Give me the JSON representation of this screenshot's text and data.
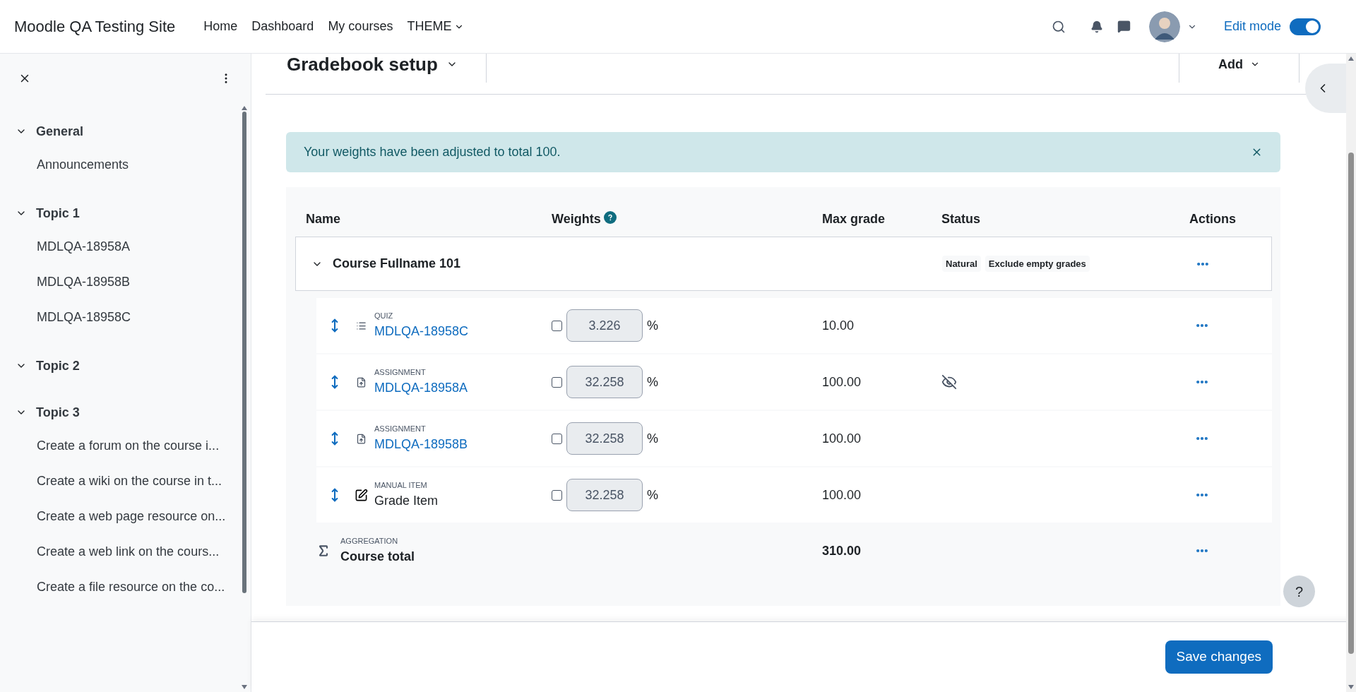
{
  "navbar": {
    "site_name": "Moodle QA Testing Site",
    "links": [
      {
        "label": "Home",
        "dropdown": false
      },
      {
        "label": "Dashboard",
        "dropdown": false
      },
      {
        "label": "My courses",
        "dropdown": false
      },
      {
        "label": "THEME",
        "dropdown": true
      }
    ],
    "edit_mode": {
      "label": "Edit mode",
      "on": true
    }
  },
  "sidebar": {
    "sections": [
      {
        "title": "General",
        "expanded": true,
        "children": [
          {
            "label": "Announcements"
          }
        ]
      },
      {
        "title": "Topic 1",
        "expanded": true,
        "children": [
          {
            "label": "MDLQA-18958A"
          },
          {
            "label": "MDLQA-18958B"
          },
          {
            "label": "MDLQA-18958C"
          }
        ]
      },
      {
        "title": "Topic 2",
        "expanded": true
      },
      {
        "title": "Topic 3",
        "expanded": true,
        "children": [
          {
            "label": "Create a forum on the course i..."
          },
          {
            "label": "Create a wiki on the course in t..."
          },
          {
            "label": "Create a web page resource on..."
          },
          {
            "label": "Create a web link on the cours..."
          },
          {
            "label": "Create a file resource on the co..."
          }
        ]
      }
    ]
  },
  "page": {
    "title": "Gradebook setup",
    "add_button": "Add"
  },
  "alert": {
    "message": "Your weights have been adjusted to total 100."
  },
  "table": {
    "columns": [
      "Name",
      "Weights",
      "Max grade",
      "Status",
      "Actions"
    ],
    "category": {
      "name": "Course Fullname 101",
      "expanded": true,
      "badges": [
        "Natural",
        "Exclude empty grades"
      ]
    },
    "items": [
      {
        "kind": "quiz",
        "type_label": "QUIZ",
        "name": "MDLQA-18958C",
        "override": false,
        "weight": "3.226",
        "unit": "%",
        "max_grade": "10.00",
        "hidden": false
      },
      {
        "kind": "assignment",
        "type_label": "ASSIGNMENT",
        "name": "MDLQA-18958A",
        "override": false,
        "weight": "32.258",
        "unit": "%",
        "max_grade": "100.00",
        "hidden": true
      },
      {
        "kind": "assignment",
        "type_label": "ASSIGNMENT",
        "name": "MDLQA-18958B",
        "override": false,
        "weight": "32.258",
        "unit": "%",
        "max_grade": "100.00",
        "hidden": false
      },
      {
        "kind": "manual",
        "type_label": "MANUAL ITEM",
        "name": "Grade Item",
        "override": false,
        "weight": "32.258",
        "unit": "%",
        "max_grade": "100.00",
        "hidden": false
      }
    ],
    "total": {
      "type_label": "AGGREGATION",
      "name": "Course total",
      "max_grade": "310.00"
    }
  },
  "help_button": "?",
  "footer": {
    "save_button": "Save changes"
  }
}
